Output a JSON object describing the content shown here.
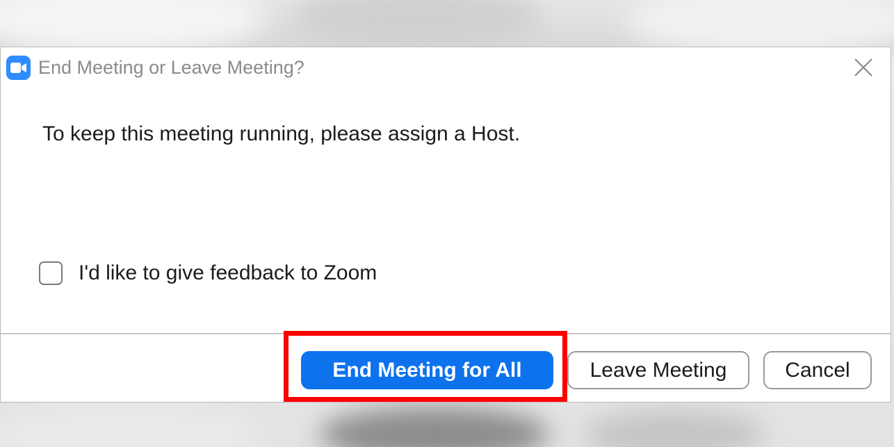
{
  "dialog": {
    "title": "End Meeting or Leave Meeting?",
    "app_icon": "zoom-camera-icon",
    "close_icon": "close-icon",
    "message": "To keep this meeting running, please assign a Host.",
    "feedback_checkbox": {
      "label": "I'd like to give feedback to Zoom",
      "checked": false
    },
    "buttons": {
      "end_for_all": "End Meeting for All",
      "leave": "Leave Meeting",
      "cancel": "Cancel"
    }
  },
  "colors": {
    "primary_button": "#0e72ed",
    "app_icon_bg": "#2d8cff",
    "highlight": "#ff0000"
  }
}
